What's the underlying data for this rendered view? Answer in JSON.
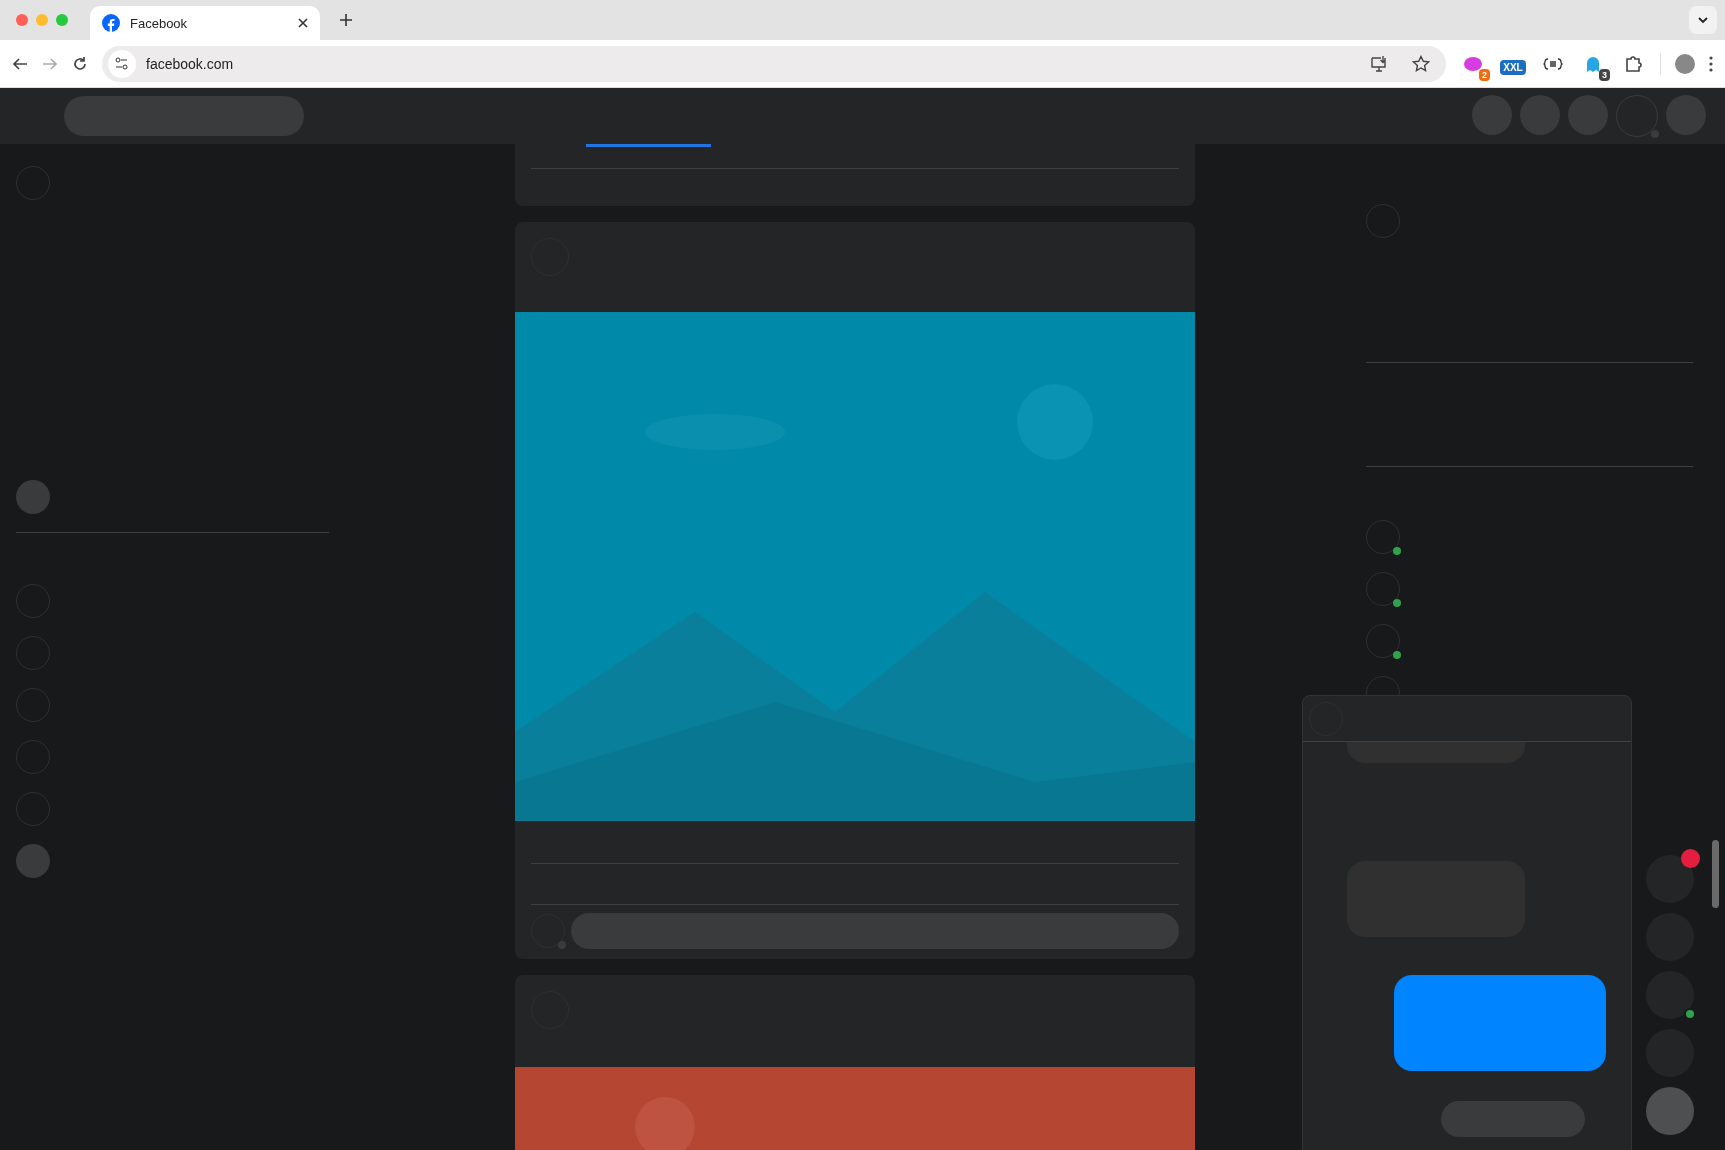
{
  "browser": {
    "tab_title": "Facebook",
    "url": "facebook.com",
    "extensions": [
      {
        "kind": "blob",
        "badge": "2"
      },
      {
        "kind": "xxl",
        "label": "XXL"
      },
      {
        "kind": "json"
      },
      {
        "kind": "ghost",
        "badge": "3"
      },
      {
        "kind": "puzzle"
      }
    ]
  },
  "contacts": [
    {
      "online": true
    },
    {
      "online": true
    },
    {
      "online": true
    },
    {
      "online": false
    }
  ],
  "chat_heads": [
    {
      "notification": true,
      "online": false
    },
    {
      "notification": false,
      "online": false
    },
    {
      "notification": false,
      "online": true
    },
    {
      "notification": false,
      "online": false
    }
  ]
}
